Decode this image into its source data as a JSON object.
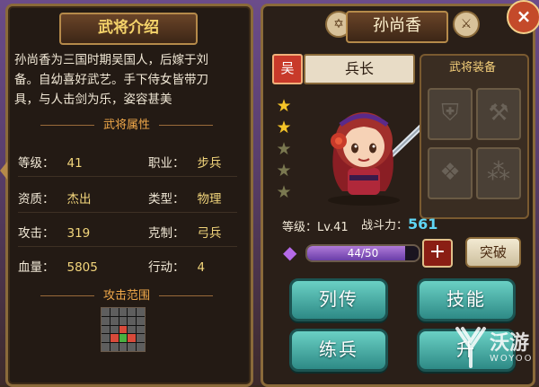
{
  "left": {
    "header": "武将介绍",
    "intro": "孙尚香为三国时期吴国人，后嫁于刘备。自幼喜好武艺。手下侍女皆带刀具，与人击剑为乐，姿容甚美",
    "attributes_title": "武将属性",
    "attributes": [
      {
        "label": "等级：",
        "value": "41"
      },
      {
        "label": "职业：",
        "value": "步兵"
      },
      {
        "label": "资质：",
        "value": "杰出"
      },
      {
        "label": "类型：",
        "value": "物理"
      },
      {
        "label": "攻击：",
        "value": "319"
      },
      {
        "label": "克制：",
        "value": "弓兵"
      },
      {
        "label": "血量：",
        "value": "5805"
      },
      {
        "label": "行动：",
        "value": "4"
      }
    ],
    "range_title": "攻击范围"
  },
  "right": {
    "name": "孙尚香",
    "faction": "吴",
    "rank": "兵长",
    "stars_lit": 2,
    "stars_total": 5,
    "equip_title": "武将装备",
    "level_label": "等级：",
    "level_value": "Lv.41",
    "power_label": "战斗力：",
    "power_value": "561",
    "exp_text": "44/50",
    "exp_fraction": 0.88,
    "plus_label": "+",
    "break_label": "突破",
    "buttons": [
      "列传",
      "技能",
      "练兵",
      "升"
    ],
    "close_label": "×"
  },
  "watermark": {
    "brand": "沃游",
    "sub": "WOYOO"
  },
  "icons": [
    "hexagram-icon",
    "sword-icon",
    "close-icon",
    "shield-slot-icon",
    "axe-slot-icon",
    "cape-slot-icon",
    "beads-slot-icon",
    "exp-gem-icon"
  ]
}
